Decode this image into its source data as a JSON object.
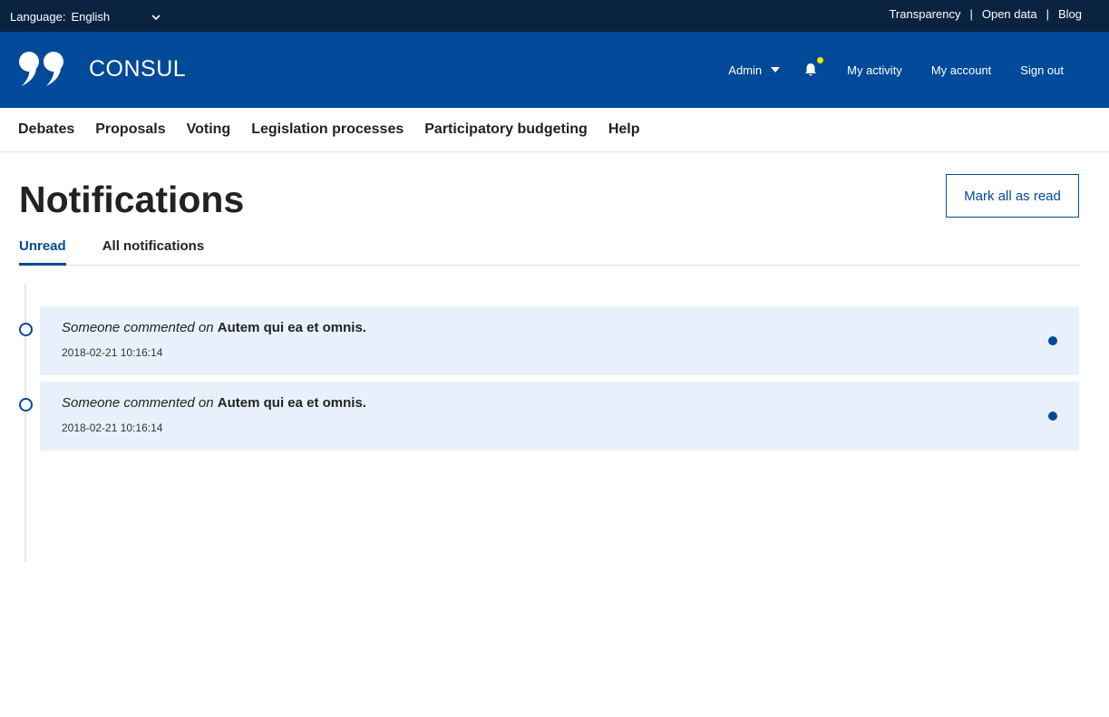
{
  "topbar": {
    "language_label": "Language:",
    "language_value": "English",
    "links": [
      "Transparency",
      "Open data",
      "Blog"
    ],
    "separator": "|"
  },
  "header": {
    "brand": "CONSUL",
    "admin_label": "Admin",
    "has_new_notifications": true,
    "nav": [
      "My activity",
      "My account",
      "Sign out"
    ]
  },
  "mainnav": {
    "items": [
      "Debates",
      "Proposals",
      "Voting",
      "Legislation processes",
      "Participatory budgeting",
      "Help"
    ]
  },
  "page": {
    "title": "Notifications",
    "mark_all_label": "Mark all as read",
    "tabs": [
      {
        "label": "Unread",
        "active": true
      },
      {
        "label": "All notifications",
        "active": false
      }
    ]
  },
  "notifications": [
    {
      "actor": "Someone commented on",
      "title": "Autem qui ea et omnis.",
      "date": "2018-02-21 10:16:14",
      "unread": true
    },
    {
      "actor": "Someone commented on",
      "title": "Autem qui ea et omnis.",
      "date": "2018-02-21 10:16:14",
      "unread": true
    }
  ],
  "colors": {
    "topbar": "#0a2340",
    "brand": "#004a99",
    "notification_bg": "#e8f1fb",
    "bell_dot": "#ffe600"
  }
}
